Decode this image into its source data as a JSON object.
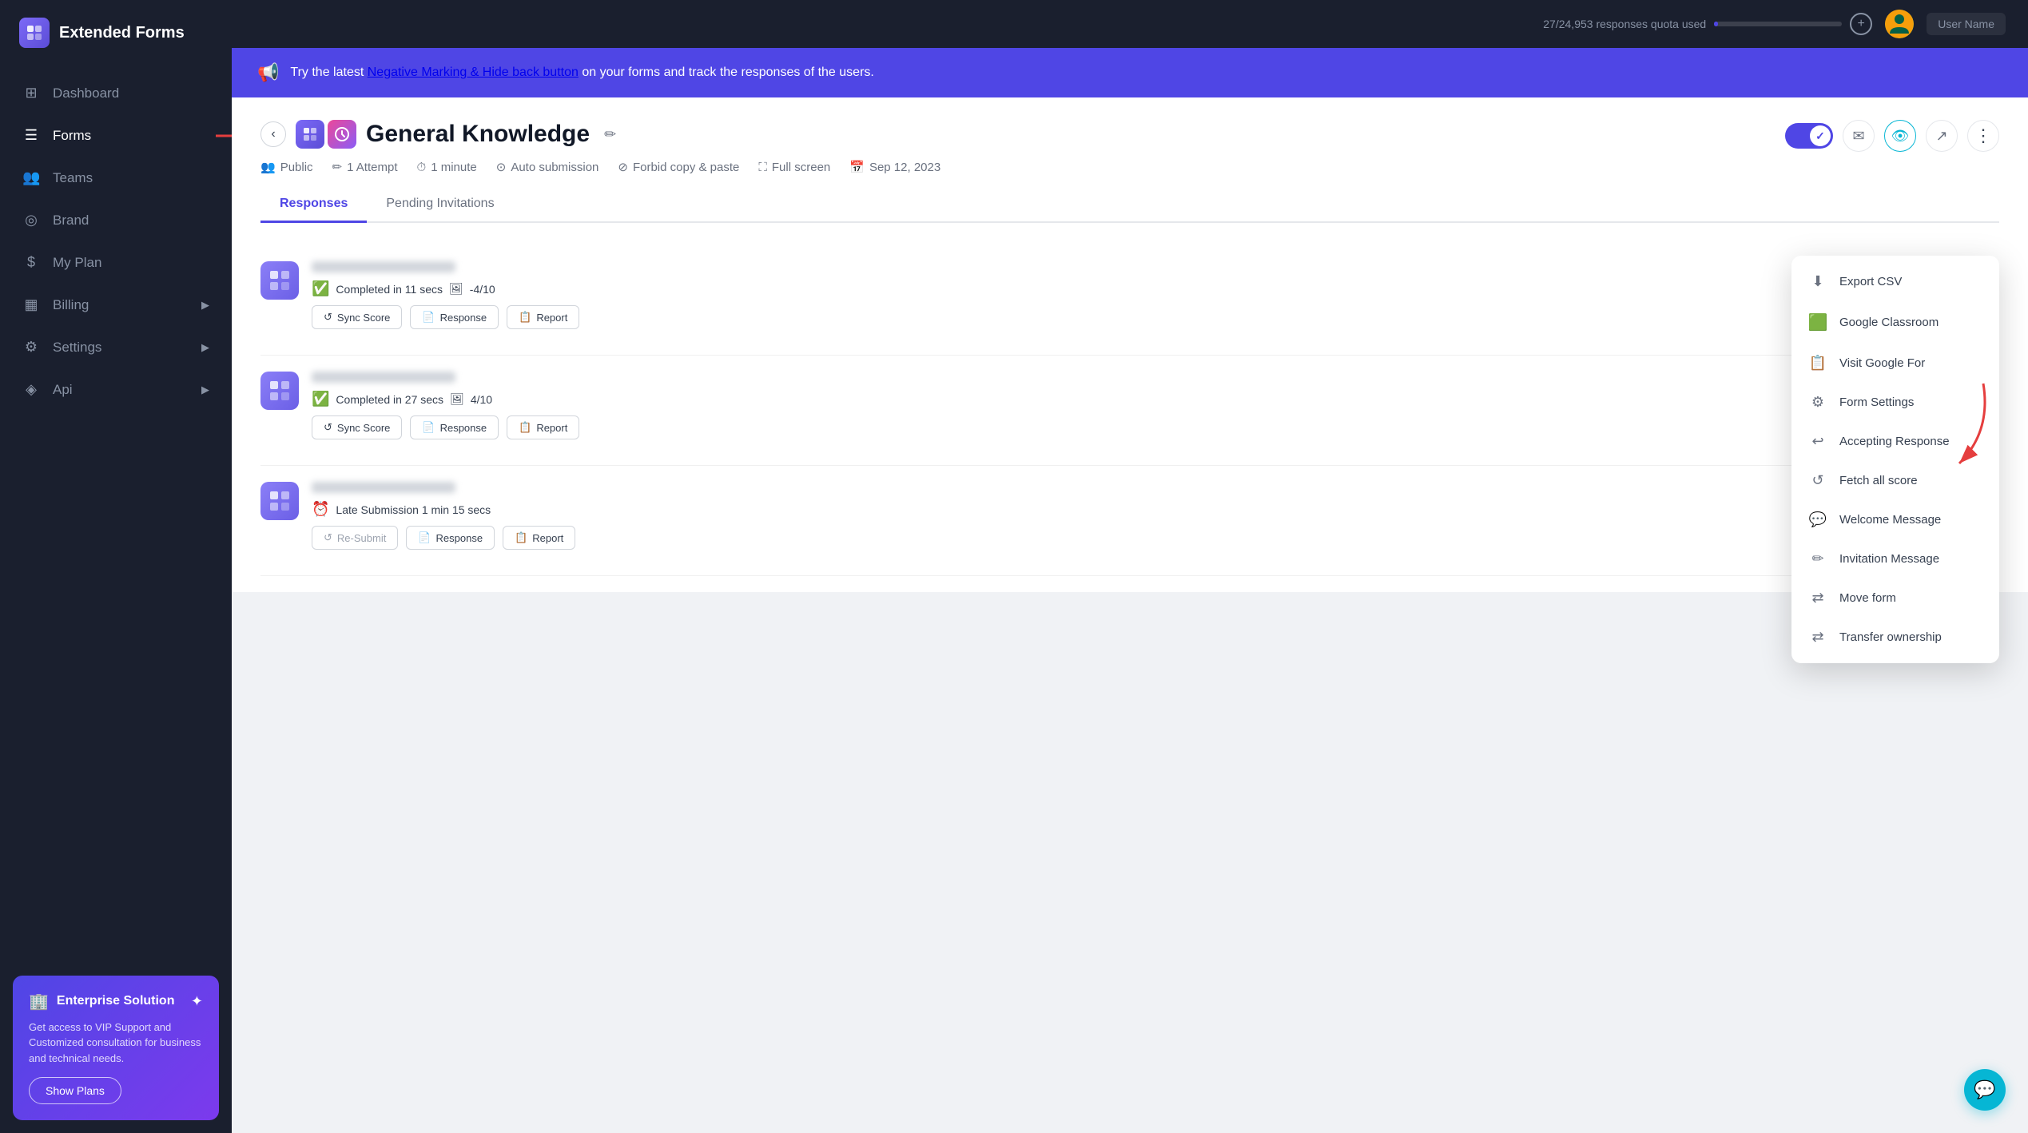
{
  "app": {
    "name": "Extended Forms"
  },
  "topbar": {
    "quota_text": "27/24,953 responses quota used",
    "quota_pct": 3,
    "user_name": "User Name"
  },
  "sidebar": {
    "nav_items": [
      {
        "id": "dashboard",
        "label": "Dashboard",
        "icon": "⊞",
        "active": false,
        "has_arrow": false
      },
      {
        "id": "forms",
        "label": "Forms",
        "icon": "≡",
        "active": true,
        "has_arrow": false
      },
      {
        "id": "teams",
        "label": "Teams",
        "icon": "👥",
        "active": false,
        "has_arrow": false
      },
      {
        "id": "brand",
        "label": "Brand",
        "icon": "$",
        "active": false,
        "has_arrow": false
      },
      {
        "id": "my-plan",
        "label": "My Plan",
        "icon": "◎",
        "active": false,
        "has_arrow": false
      },
      {
        "id": "billing",
        "label": "Billing",
        "icon": "▦",
        "active": false,
        "has_arrow": true
      },
      {
        "id": "settings",
        "label": "Settings",
        "icon": "⚙",
        "active": false,
        "has_arrow": true
      },
      {
        "id": "api",
        "label": "Api",
        "icon": "◈",
        "active": false,
        "has_arrow": true
      }
    ],
    "enterprise": {
      "title": "Enterprise Solution",
      "desc": "Get access to VIP Support and Customized consultation for business and technical needs.",
      "btn_label": "Show Plans"
    }
  },
  "banner": {
    "text_prefix": "Try the latest ",
    "link_text": "Negative Marking & Hide back button",
    "text_suffix": " on your forms and track the responses of the users."
  },
  "form": {
    "title": "General Knowledge",
    "meta": {
      "visibility": "Public",
      "attempts": "1 Attempt",
      "duration": "1 minute",
      "submission": "Auto submission",
      "copy_paste": "Forbid copy & paste",
      "fullscreen": "Full screen",
      "date": "Sep 12, 2023"
    },
    "tabs": [
      {
        "id": "responses",
        "label": "Responses",
        "active": true
      },
      {
        "id": "pending-invitations",
        "label": "Pending Invitations",
        "active": false
      }
    ],
    "responses": [
      {
        "id": 1,
        "status": "completed",
        "status_text": "Completed in 11 secs",
        "score": "-4/10",
        "actions": [
          "Sync Score",
          "Response",
          "Report"
        ],
        "has_close": true
      },
      {
        "id": 2,
        "status": "completed",
        "status_text": "Completed in 27 secs",
        "score": "4/10",
        "actions": [
          "Sync Score",
          "Response",
          "Report"
        ],
        "has_close": true
      },
      {
        "id": 3,
        "status": "late",
        "status_text": "Late Submission 1 min 15 secs",
        "score": "",
        "actions": [
          "Re-Submit",
          "Response",
          "Report"
        ],
        "has_close": true
      }
    ],
    "dropdown_items": [
      {
        "id": "export-csv",
        "label": "Export CSV",
        "icon": "⬇",
        "icon_color": "gray"
      },
      {
        "id": "google-classroom",
        "label": "Google Classroom",
        "icon": "🟩",
        "icon_color": "green"
      },
      {
        "id": "visit-google-form",
        "label": "Visit Google For",
        "icon": "📄",
        "icon_color": "purple"
      },
      {
        "id": "form-settings",
        "label": "Form Settings",
        "icon": "⚙",
        "icon_color": "gray"
      },
      {
        "id": "accepting-response",
        "label": "Accepting Response",
        "icon": "↩",
        "icon_color": "gray"
      },
      {
        "id": "fetch-all-score",
        "label": "Fetch all score",
        "icon": "↺",
        "icon_color": "gray"
      },
      {
        "id": "welcome-message",
        "label": "Welcome Message",
        "icon": "💬",
        "icon_color": "gray"
      },
      {
        "id": "invitation-message",
        "label": "Invitation Message",
        "icon": "✏",
        "icon_color": "gray"
      },
      {
        "id": "move-form",
        "label": "Move form",
        "icon": "⇌",
        "icon_color": "gray"
      },
      {
        "id": "transfer-ownership",
        "label": "Transfer ownership",
        "icon": "⇌",
        "icon_color": "gray"
      }
    ]
  },
  "labels": {
    "atte": "Atte",
    "sync_score": "Sync Score",
    "response": "Response",
    "report": "Report",
    "re_submit": "Re-Submit"
  }
}
